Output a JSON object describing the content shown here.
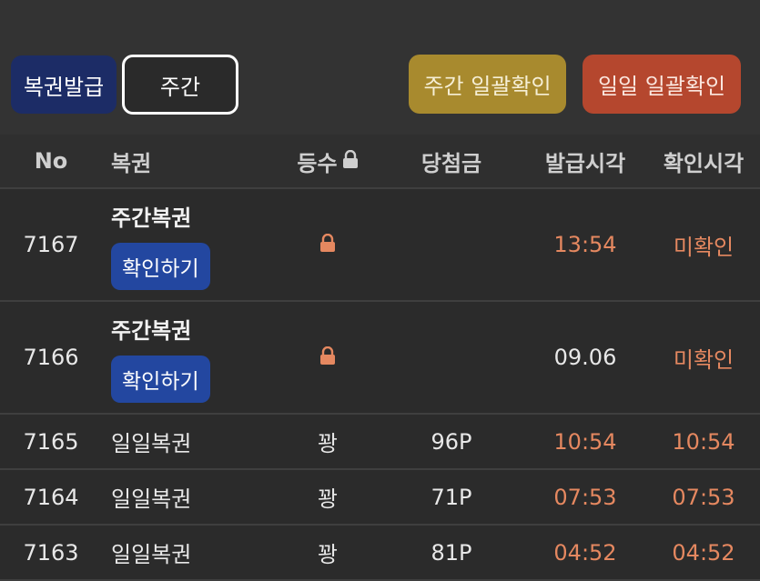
{
  "toolbar": {
    "issue_label": "복권발급",
    "weekly_label": "주간",
    "weekly_check_all_label": "주간 일괄확인",
    "daily_check_all_label": "일일 일괄확인"
  },
  "table": {
    "headers": {
      "no": "No",
      "ticket": "복권",
      "rank": "등수",
      "prize": "당첨금",
      "issued_time": "발급시각",
      "checked_time": "확인시각"
    },
    "rows": [
      {
        "no": "7167",
        "ticket": "주간복권",
        "check_button": "확인하기",
        "rank_icon": "lock-icon",
        "prize": "",
        "issued_time": "13:54",
        "checked_time": "미확인"
      },
      {
        "no": "7166",
        "ticket": "주간복권",
        "check_button": "확인하기",
        "rank_icon": "lock-icon",
        "prize": "",
        "issued_time": "09.06",
        "checked_time": "미확인"
      },
      {
        "no": "7165",
        "ticket": "일일복권",
        "rank": "꽝",
        "prize": "96P",
        "issued_time": "10:54",
        "checked_time": "10:54"
      },
      {
        "no": "7164",
        "ticket": "일일복권",
        "rank": "꽝",
        "prize": "71P",
        "issued_time": "07:53",
        "checked_time": "07:53"
      },
      {
        "no": "7163",
        "ticket": "일일복권",
        "rank": "꽝",
        "prize": "81P",
        "issued_time": "04:52",
        "checked_time": "04:52"
      }
    ]
  },
  "colors": {
    "background": "#333333",
    "issue_button": "#1c2c66",
    "weekly_check_all": "#a88a2e",
    "daily_check_all": "#b5472e",
    "check_button": "#2347a0",
    "accent_orange": "#e58860"
  }
}
